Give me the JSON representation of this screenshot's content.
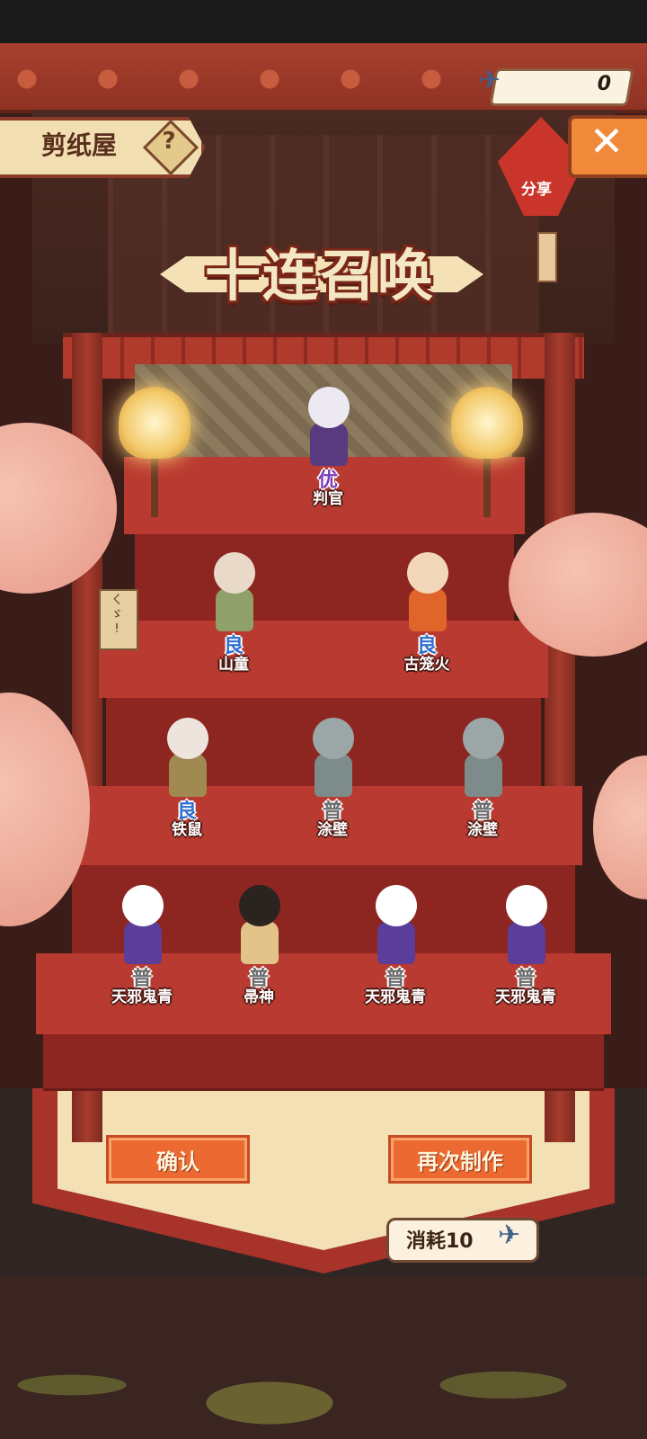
{
  "header": {
    "title": "剪纸屋",
    "help_glyph": "?",
    "currency_value": "0",
    "close_glyph": "✕",
    "share_label": "分享"
  },
  "banner": {
    "title": "十连召唤"
  },
  "side_sign": {
    "text": "ㄑ\nゞ\n!"
  },
  "results": [
    {
      "rank": "优",
      "rank_class": "sr",
      "name": "判官",
      "head_color": "#ece9f2",
      "body_color": "#5a3a7e"
    },
    {
      "rank": "良",
      "rank_class": "r",
      "name": "山童",
      "head_color": "#e8d9c8",
      "body_color": "#8fa06a"
    },
    {
      "rank": "良",
      "rank_class": "r",
      "name": "古笼火",
      "head_color": "#f2d6b8",
      "body_color": "#e0652a"
    },
    {
      "rank": "良",
      "rank_class": "r",
      "name": "铁鼠",
      "head_color": "#ece4dd",
      "body_color": "#a08a52"
    },
    {
      "rank": "普",
      "rank_class": "n",
      "name": "涂壁",
      "head_color": "#9aa7a6",
      "body_color": "#7d8c8b"
    },
    {
      "rank": "普",
      "rank_class": "n",
      "name": "涂壁",
      "head_color": "#9aa7a6",
      "body_color": "#7d8c8b"
    },
    {
      "rank": "普",
      "rank_class": "n",
      "name": "天邪鬼青",
      "head_color": "#ffffff",
      "body_color": "#5b3d9a"
    },
    {
      "rank": "普",
      "rank_class": "n",
      "name": "帚神",
      "head_color": "#2a2320",
      "body_color": "#e2c48a"
    },
    {
      "rank": "普",
      "rank_class": "n",
      "name": "天邪鬼青",
      "head_color": "#ffffff",
      "body_color": "#5b3d9a"
    },
    {
      "rank": "普",
      "rank_class": "n",
      "name": "天邪鬼青",
      "head_color": "#ffffff",
      "body_color": "#5b3d9a"
    }
  ],
  "actions": {
    "confirm_label": "确认",
    "remake_label": "再次制作",
    "cost_label": "消耗10"
  },
  "colors": {
    "accent": "#ec6a32",
    "rank_sr": "#7a3db8",
    "rank_r": "#2f6fcf",
    "rank_n": "#6c6c6c"
  },
  "icons": {
    "currency": "paper-crane-icon",
    "close": "close-icon",
    "help": "question-icon"
  }
}
